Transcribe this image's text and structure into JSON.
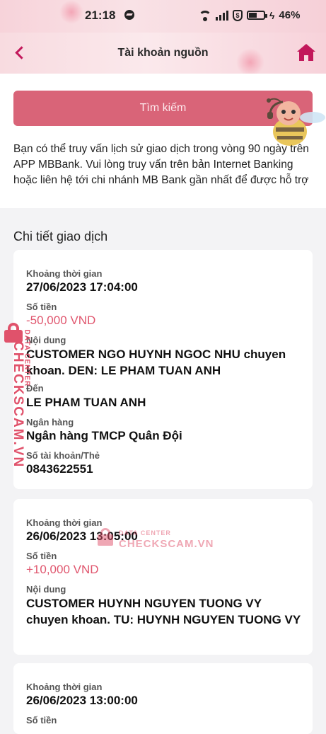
{
  "status_bar": {
    "time": "21:18",
    "battery": "46%"
  },
  "header": {
    "title": "Tài khoản nguồn"
  },
  "search": {
    "button_label": "Tìm kiếm"
  },
  "info": {
    "text": "Bạn có thể truy vấn lịch sử giao dịch trong vòng 90 ngày trên APP MBBank. Vui lòng truy vấn trên bản Internet Banking hoặc liên hệ tới chi nhánh MB Bank gần nhất để được hỗ trợ"
  },
  "section": {
    "title": "Chi tiết giao dịch"
  },
  "transactions": [
    {
      "time_label": "Khoảng thời gian",
      "time": "27/06/2023 17:04:00",
      "amount_label": "Số tiền",
      "amount": "-50,000 VND",
      "content_label": "Nội dung",
      "content": "CUSTOMER NGO HUYNH NGOC NHU chuyen khoan. DEN: LE PHAM TUAN ANH",
      "to_label": "Đến",
      "to": "LE PHAM TUAN ANH",
      "bank_label": "Ngân hàng",
      "bank": "Ngân hàng TMCP Quân Đội",
      "account_label": "Số tài khoản/Thẻ",
      "account": "0843622551"
    },
    {
      "time_label": "Khoảng thời gian",
      "time": "26/06/2023 13:05:00",
      "amount_label": "Số tiền",
      "amount": "+10,000 VND",
      "content_label": "Nội dung",
      "content": "CUSTOMER HUYNH NGUYEN TUONG VY chuyen khoan. TU: HUYNH NGUYEN TUONG VY"
    },
    {
      "time_label": "Khoảng thời gian",
      "time": "26/06/2023 13:00:00",
      "amount_label": "Số tiền"
    }
  ],
  "watermark": {
    "side_text": "CHECKSCAM.VN",
    "side_small": "DATA CENTER",
    "center_small": "DATA CENTER",
    "center_text": "CHECKSCAM.VN"
  },
  "colors": {
    "accent": "#c2185b",
    "button": "#d96478",
    "amount": "#e0566e",
    "header_bg": "#f8dbe0"
  }
}
